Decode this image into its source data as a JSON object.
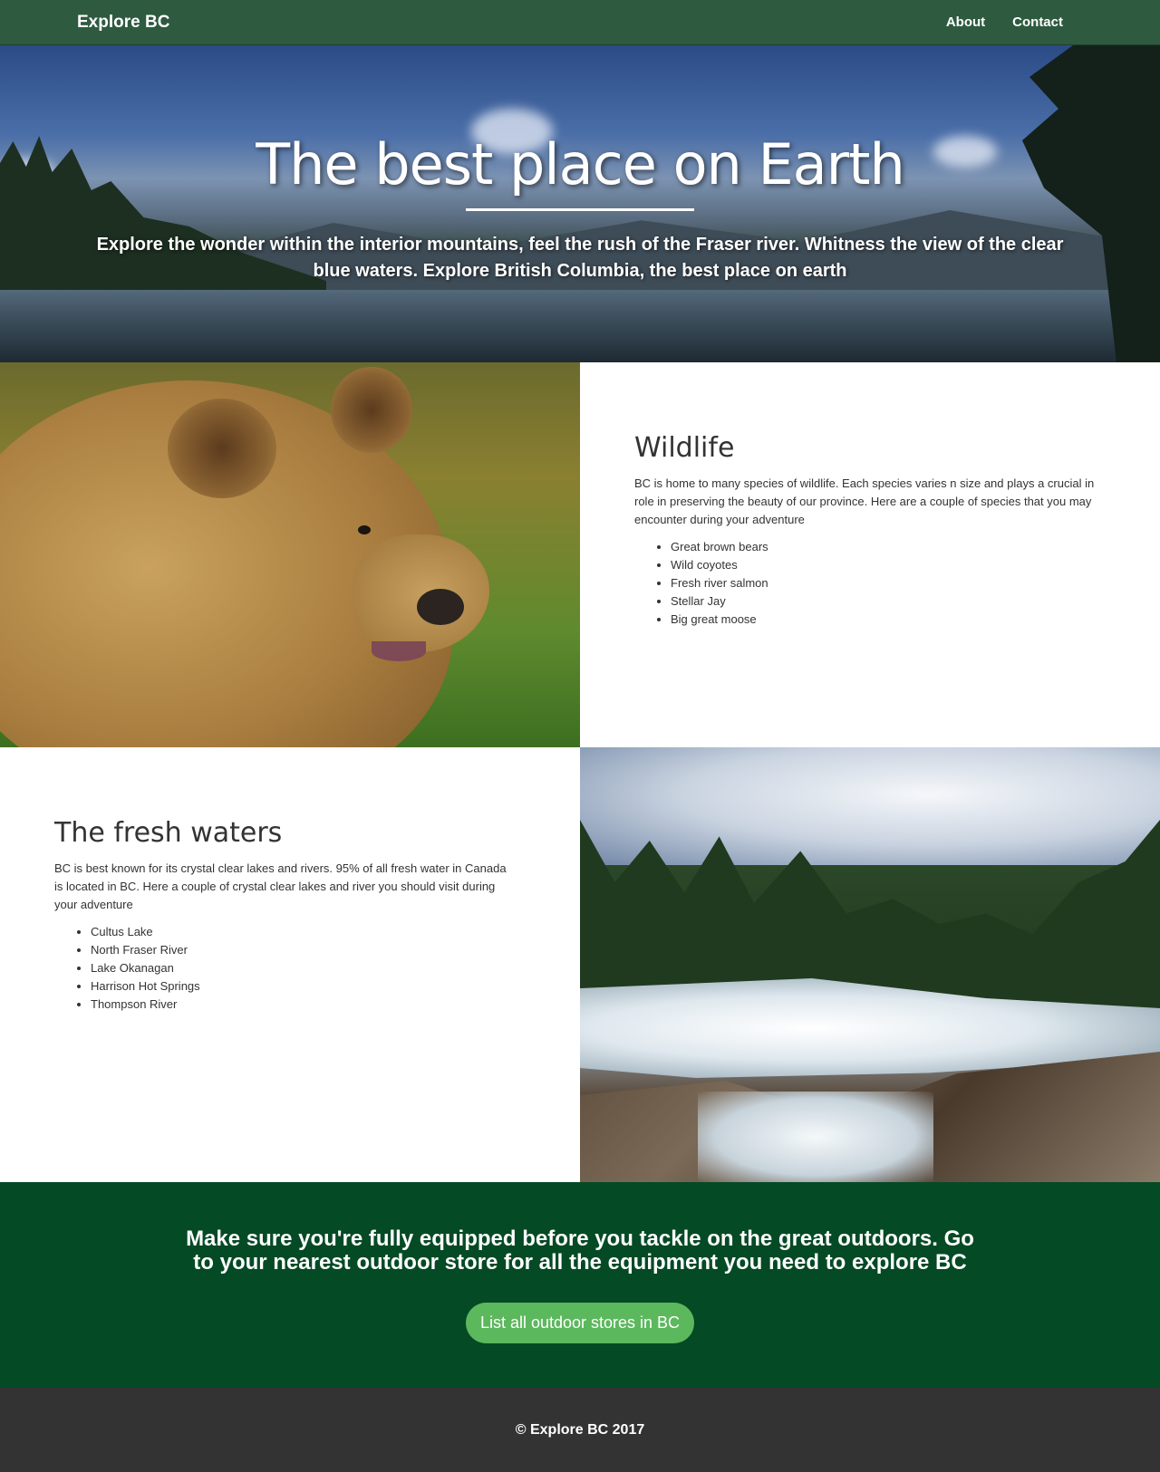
{
  "nav": {
    "brand": "Explore BC",
    "links": [
      "About",
      "Contact"
    ]
  },
  "hero": {
    "title": "The best place on Earth",
    "subtitle": "Explore the wonder within the interior mountains, feel the rush of the Fraser river. Whitness the view of the clear blue waters. Explore British Columbia, the best place on earth"
  },
  "wildlife": {
    "title": "Wildlife",
    "description": "BC is home to many species of wildlife. Each species varies n size and plays a crucial in role in preserving the beauty of our province. Here are a couple of species that you may encounter during your adventure",
    "items": [
      "Great brown bears",
      "Wild coyotes",
      "Fresh river salmon",
      "Stellar Jay",
      "Big great moose"
    ]
  },
  "waters": {
    "title": "The fresh waters",
    "description": "BC is best known for its crystal clear lakes and rivers. 95% of all fresh water in Canada is located in BC. Here a couple of crystal clear lakes and river you should visit during your adventure",
    "items": [
      "Cultus Lake",
      "North Fraser River",
      "Lake Okanagan",
      "Harrison Hot Springs",
      "Thompson River"
    ]
  },
  "cta": {
    "text": "Make sure you're fully equipped before you tackle on the great outdoors. Go to your nearest outdoor store for all the equipment you need to explore BC",
    "button_label": "List all outdoor stores in BC"
  },
  "footer": {
    "text": "© Explore BC 2017"
  },
  "colors": {
    "navbar": "#2e5a40",
    "cta_background": "#044a25",
    "cta_button": "#5cb85c",
    "footer": "#333333"
  }
}
